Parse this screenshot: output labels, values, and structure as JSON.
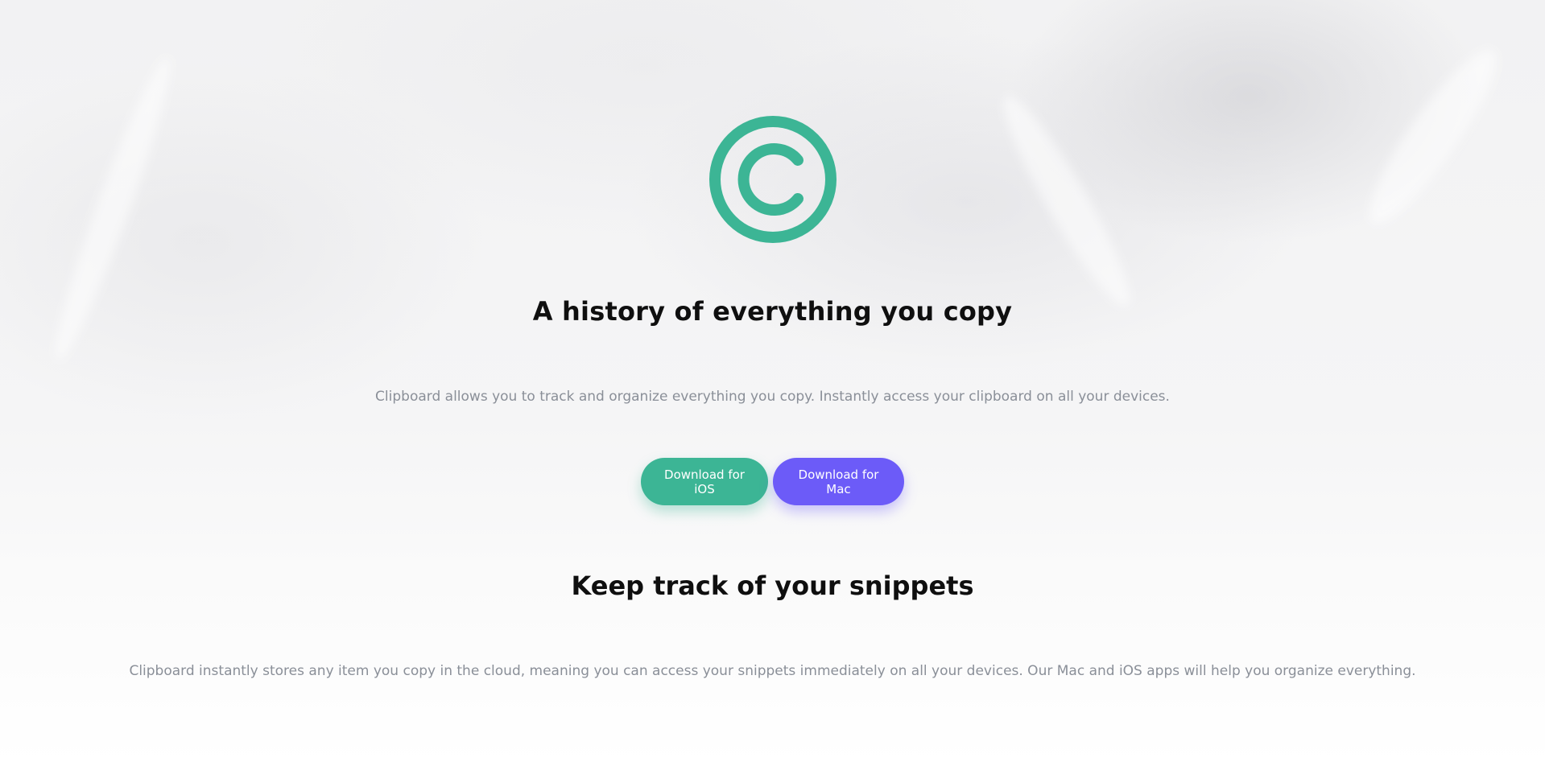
{
  "colors": {
    "brand_green": "#3cb595",
    "brand_purple": "#6c5bf8",
    "heading": "#0f0f0f",
    "body_text": "#8a8f98"
  },
  "hero": {
    "logo_icon": "copyright-c-logo-icon",
    "title": "A history of everything you copy",
    "subtitle": "Clipboard allows you to track and organize everything you copy. Instantly access your clipboard on all your devices.",
    "buttons": {
      "ios_label": "Download for iOS",
      "mac_label": "Download for Mac"
    }
  },
  "snippets": {
    "title": "Keep track of your snippets",
    "text": "Clipboard instantly stores any item you copy in the cloud, meaning you can access your snippets immediately on all your devices. Our Mac and iOS apps will help you organize everything."
  }
}
